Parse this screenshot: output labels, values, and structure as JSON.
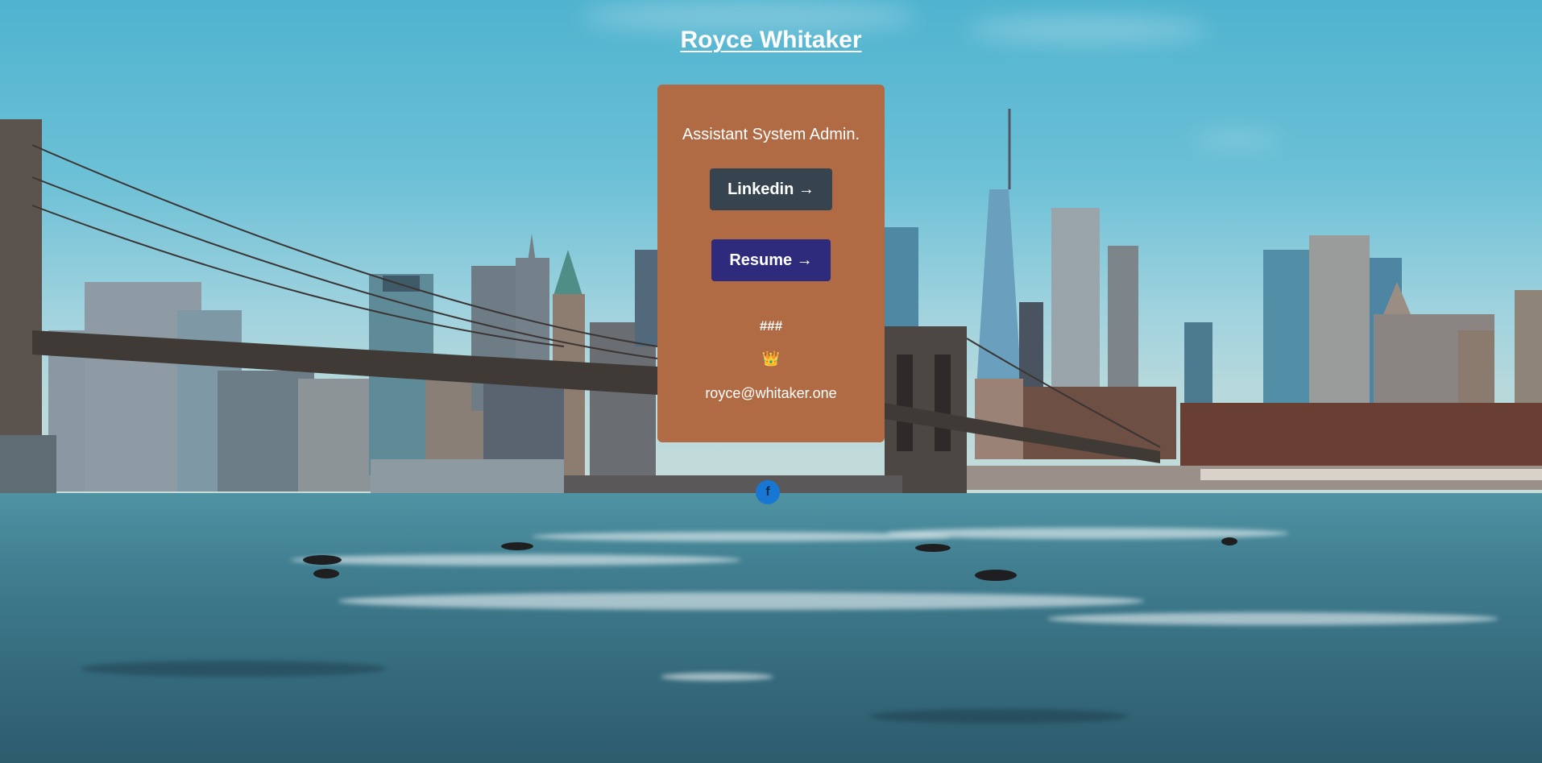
{
  "header": {
    "title": "Royce Whitaker"
  },
  "card": {
    "role": "Assistant System Admin.",
    "linkedin_label": "Linkedin →",
    "resume_label": "Resume →",
    "hashes": "###",
    "crown_icon": "👑",
    "email": "royce@whitaker.one"
  },
  "social": {
    "facebook_icon": "f"
  },
  "colors": {
    "card_bg": "#b06b45",
    "linkedin_bg": "#35444e",
    "resume_bg": "#2e2a7c",
    "facebook": "#1877d2"
  },
  "icons": {
    "crown": "crown-icon",
    "facebook": "facebook-icon"
  }
}
